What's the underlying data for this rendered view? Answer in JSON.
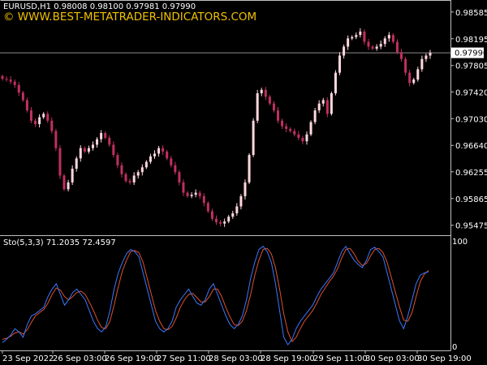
{
  "window": {
    "symbol_info": "EURUSD,H1  0.98008 0.98100 0.97981 0.97990",
    "watermark": "© WWW.BEST-METATRADER-INDICATORS.COM",
    "current_price_label": "0.97990",
    "current_price": 0.9799
  },
  "colors": {
    "background": "#000000",
    "bull_candle": "#ffd7df",
    "bear_candle": "#c03060",
    "frame": "#c0c0c0",
    "watermark": "#f0c000",
    "stoch_main": "#3a78ff",
    "stoch_signal": "#e0502a",
    "price_line": "#8c8c8c"
  },
  "price_axis": {
    "ticks": [
      "0.98585",
      "0.98195",
      "0.97805",
      "0.97420",
      "0.97030",
      "0.96640",
      "0.96255",
      "0.95865",
      "0.95475"
    ],
    "ylim": [
      0.9533,
      0.9876
    ]
  },
  "time_axis": {
    "labels": [
      "23 Sep 2022",
      "26 Sep 03:00",
      "26 Sep 19:00",
      "27 Sep 11:00",
      "28 Sep 03:00",
      "28 Sep 19:00",
      "29 Sep 11:00",
      "30 Sep 03:00",
      "30 Sep 19:00"
    ]
  },
  "indicator": {
    "title": "Sto(5,3,3) 71.2035 72.4597",
    "scale_top": "100",
    "scale_bottom": "0",
    "main_value": 71.2035,
    "signal_value": 72.4597
  },
  "chart_data": {
    "type": "candlestick",
    "title": "EURUSD,H1",
    "price_closes": [
      0.9761,
      0.976,
      0.9757,
      0.9752,
      0.9741,
      0.973,
      0.9715,
      0.97,
      0.9695,
      0.9705,
      0.971,
      0.97,
      0.9685,
      0.966,
      0.962,
      0.96,
      0.961,
      0.963,
      0.9645,
      0.966,
      0.9655,
      0.966,
      0.9665,
      0.9673,
      0.9682,
      0.9675,
      0.9665,
      0.965,
      0.9635,
      0.9622,
      0.9612,
      0.961,
      0.962,
      0.9625,
      0.9632,
      0.964,
      0.9648,
      0.9652,
      0.966,
      0.9655,
      0.9645,
      0.9635,
      0.9625,
      0.961,
      0.9595,
      0.959,
      0.9592,
      0.9595,
      0.959,
      0.958,
      0.9568,
      0.9557,
      0.9552,
      0.955,
      0.9553,
      0.956,
      0.9565,
      0.9575,
      0.959,
      0.961,
      0.965,
      0.97,
      0.974,
      0.9745,
      0.9735,
      0.9725,
      0.9715,
      0.97,
      0.9692,
      0.9688,
      0.9685,
      0.968,
      0.9675,
      0.967,
      0.968,
      0.9698,
      0.9715,
      0.9725,
      0.973,
      0.971,
      0.974,
      0.977,
      0.9795,
      0.9808,
      0.982,
      0.9822,
      0.9825,
      0.983,
      0.9815,
      0.9808,
      0.9805,
      0.9808,
      0.9812,
      0.982,
      0.9825,
      0.9815,
      0.98,
      0.979,
      0.977,
      0.9755,
      0.976,
      0.9775,
      0.979,
      0.9795,
      0.9799
    ],
    "stoch_main": [
      5,
      8,
      12,
      18,
      15,
      10,
      22,
      30,
      32,
      35,
      38,
      48,
      55,
      60,
      50,
      40,
      45,
      52,
      55,
      50,
      45,
      35,
      25,
      18,
      15,
      20,
      35,
      55,
      70,
      80,
      88,
      92,
      90,
      85,
      70,
      55,
      40,
      25,
      18,
      15,
      18,
      25,
      38,
      45,
      50,
      55,
      48,
      42,
      40,
      45,
      55,
      60,
      50,
      40,
      30,
      22,
      18,
      22,
      30,
      45,
      65,
      80,
      92,
      95,
      90,
      80,
      60,
      35,
      10,
      3,
      8,
      18,
      25,
      30,
      35,
      40,
      48,
      55,
      60,
      65,
      70,
      80,
      90,
      95,
      88,
      82,
      78,
      75,
      82,
      92,
      94,
      90,
      85,
      70,
      55,
      40,
      25,
      18,
      30,
      45,
      60,
      68,
      70,
      71.2035
    ],
    "stoch_signal": [
      8,
      9,
      11,
      14,
      15,
      13,
      17,
      24,
      30,
      33,
      36,
      42,
      50,
      56,
      54,
      48,
      45,
      48,
      52,
      53,
      50,
      43,
      35,
      26,
      19,
      18,
      25,
      40,
      57,
      72,
      82,
      90,
      91,
      89,
      80,
      65,
      50,
      35,
      25,
      18,
      17,
      20,
      28,
      38,
      45,
      50,
      51,
      47,
      43,
      43,
      48,
      55,
      55,
      48,
      38,
      29,
      22,
      21,
      25,
      35,
      50,
      68,
      82,
      92,
      93,
      88,
      75,
      55,
      32,
      15,
      6,
      10,
      18,
      25,
      30,
      35,
      42,
      50,
      56,
      62,
      67,
      74,
      84,
      92,
      93,
      88,
      81,
      77,
      79,
      86,
      92,
      93,
      89,
      80,
      66,
      52,
      38,
      26,
      25,
      33,
      48,
      62,
      69,
      72.4597
    ]
  }
}
